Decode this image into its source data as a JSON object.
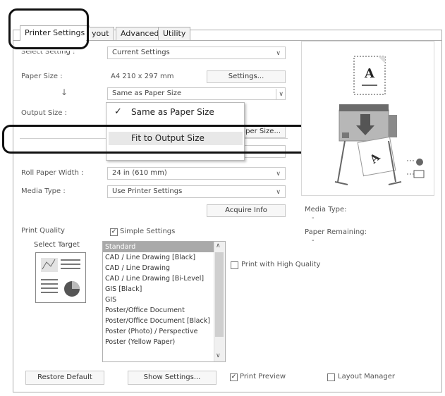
{
  "tabs": [
    {
      "label": "Printer Settings"
    },
    {
      "label": "yout"
    },
    {
      "label": "Advanced"
    },
    {
      "label": "Utility"
    }
  ],
  "select_setting": {
    "label": "Select Setting :",
    "value": "Current Settings"
  },
  "paper_size": {
    "label": "Paper Size :",
    "value": "A4 210 x 297 mm",
    "settings_button": "Settings..."
  },
  "arrow_glyph": "↓",
  "paper_combo": {
    "value": "Same as Paper Size"
  },
  "output_size": {
    "label": "Output Size :"
  },
  "dropdown": {
    "checked_item": "Same as Paper Size",
    "highlighted_item": "Fit to Output Size",
    "check_glyph": "✓"
  },
  "partial_button_text": "aper Size...",
  "roll_paper_width": {
    "label": "Roll Paper Width :",
    "value": "24 in (610 mm)"
  },
  "media_type": {
    "label": "Media Type :",
    "value": "Use Printer Settings",
    "acquire_button": "Acquire Info"
  },
  "print_quality": {
    "label": "Print Quality",
    "simple_settings": "Simple Settings",
    "select_target": "Select Target",
    "targets": [
      "Standard",
      "CAD / Line Drawing [Black]",
      "CAD / Line Drawing",
      "CAD / Line Drawing [Bi-Level]",
      "GIS [Black]",
      "GIS",
      "Poster/Office Document",
      "Poster/Office Document [Black]",
      "Poster (Photo) / Perspective",
      "Poster (Yellow Paper)"
    ],
    "selected_target": "Standard",
    "high_quality": "Print with High Quality"
  },
  "info": {
    "media_type_label": "Media Type:",
    "media_type_value": "-",
    "paper_remaining_label": "Paper Remaining:",
    "paper_remaining_value": "-"
  },
  "preview": {
    "paper_letter": "A"
  },
  "bottom": {
    "restore": "Restore Default",
    "show_settings": "Show Settings...",
    "print_preview": "Print Preview",
    "layout_manager": "Layout Manager"
  }
}
